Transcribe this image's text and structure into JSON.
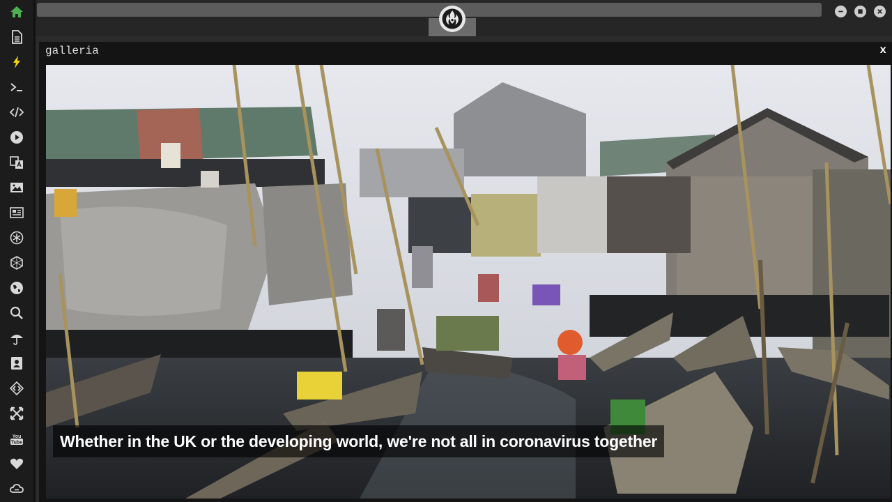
{
  "sidebar": {
    "items": [
      {
        "name": "home-icon",
        "active": true
      },
      {
        "name": "document-icon"
      },
      {
        "name": "lightning-icon"
      },
      {
        "name": "terminal-icon"
      },
      {
        "name": "code-icon"
      },
      {
        "name": "play-icon"
      },
      {
        "name": "translate-icon"
      },
      {
        "name": "image-icon"
      },
      {
        "name": "news-icon"
      },
      {
        "name": "asterisk-icon"
      },
      {
        "name": "hexagon-icon"
      },
      {
        "name": "globe-icon"
      },
      {
        "name": "search-icon"
      },
      {
        "name": "umbrella-icon"
      },
      {
        "name": "contact-icon"
      },
      {
        "name": "dev-icon"
      },
      {
        "name": "expand-icon"
      },
      {
        "name": "youtube-icon"
      },
      {
        "name": "heart-icon"
      },
      {
        "name": "cloud-icon"
      }
    ],
    "youtube_label": "You Tube"
  },
  "colors": {
    "active_icon": "#4caf50",
    "highlight_icon": "#f2d21b",
    "icon": "#d8d8d8"
  },
  "window": {
    "title": "galleria",
    "close_label": "x"
  },
  "gallery": {
    "caption": "Whether in the UK or the developing world, we're not all in coronavirus together"
  }
}
